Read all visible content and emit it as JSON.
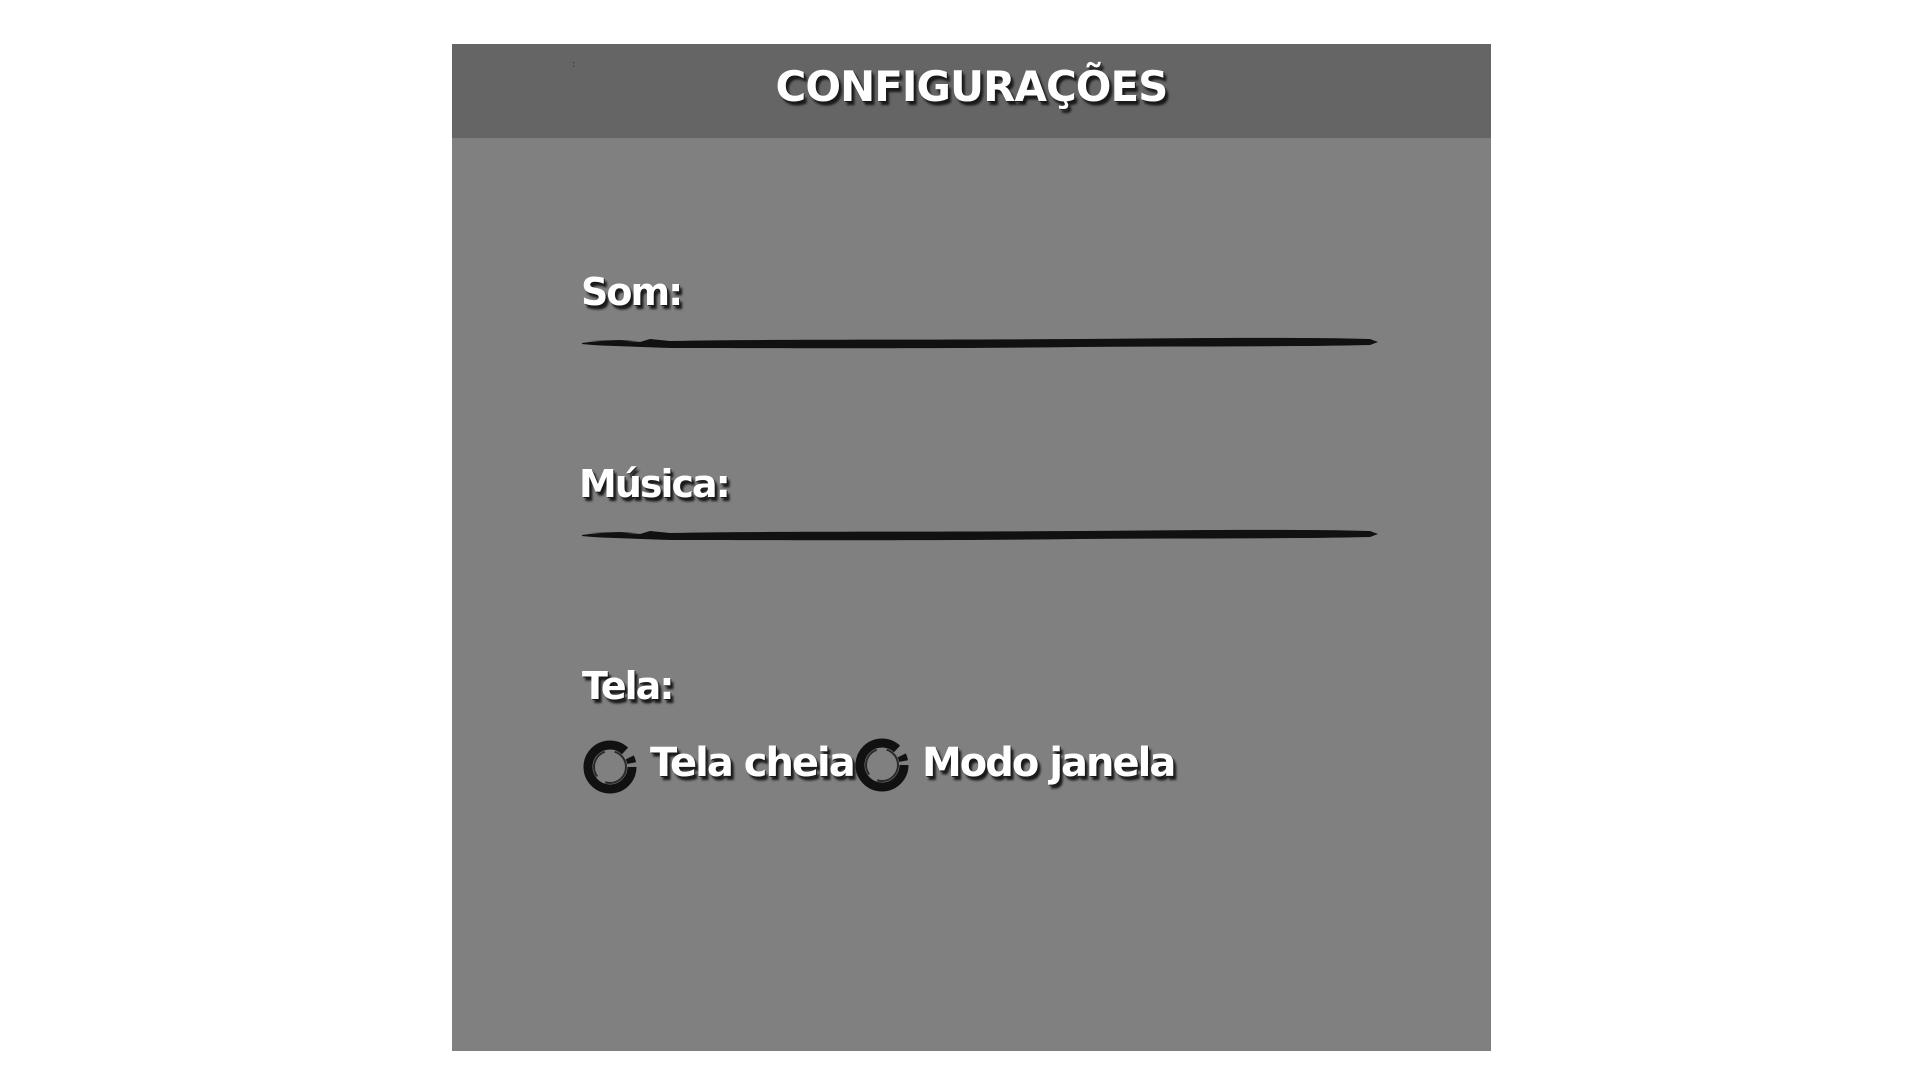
{
  "header": {
    "title": "CONFIGURAÇÕES",
    "dots": ":"
  },
  "settings": {
    "sound": {
      "label": "Som:"
    },
    "music": {
      "label": "Música:"
    },
    "screen": {
      "label": "Tela:",
      "options": [
        {
          "label": "Tela cheia",
          "selected": false
        },
        {
          "label": "Modo janela",
          "selected": false
        }
      ]
    }
  },
  "colors": {
    "panel": "#808080",
    "header": "#656565",
    "ink": "#111111",
    "text": "#ffffff"
  }
}
